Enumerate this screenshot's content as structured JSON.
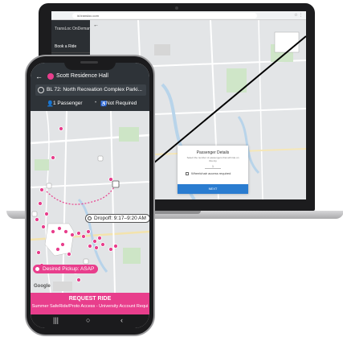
{
  "laptop": {
    "browser_url": "id.transloc.com",
    "browser_icons": "☆ ⋮",
    "sidebar": {
      "title": "TransLoc   OnDemand",
      "book": "Book a Ride"
    },
    "back_icon": "←",
    "modal": {
      "title": "Passenger Details",
      "subtitle": "Select the number of passengers that will ride on this trip",
      "field_value": "1",
      "checkbox_label": "Wheelchair access required",
      "next_label": "NEXT"
    }
  },
  "phone": {
    "back_icon": "←",
    "origin": "Scott Residence Hall",
    "destination": "BL 72: North Recreation Complex Parki...",
    "passenger_icon": "👤",
    "passengers": "1 Passenger",
    "separator": "•",
    "access_icon": "♿",
    "accessibility": "Not Required",
    "dropoff_label": "Dropoff: 9:17–9:20 AM",
    "pickup_label": "Desired Pickup: ASAP",
    "map_attribution": "Google",
    "request_label": "REQUEST RIDE",
    "request_sub": "Summer SafeRide/Proto Access - University Account Requi",
    "nav": {
      "recents": "|||",
      "home": "○",
      "back": "‹"
    },
    "colors": {
      "accent": "#e83e8c",
      "header": "#2e3338"
    }
  }
}
